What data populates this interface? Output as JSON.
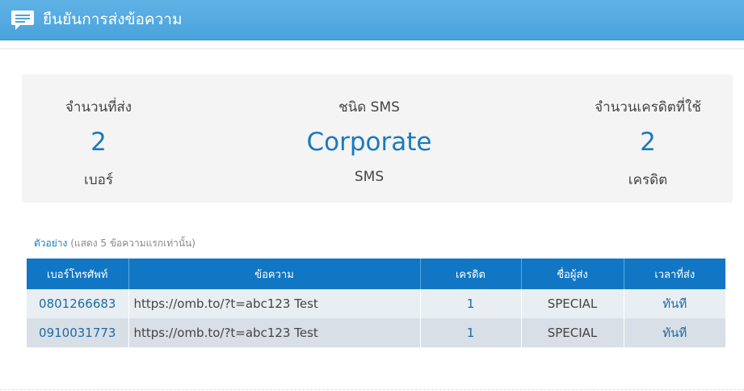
{
  "header": {
    "title": "ยืนยันการส่งข้อความ",
    "icon": "chat-icon"
  },
  "summary": {
    "count_label": "จำนวนที่ส่ง",
    "count_value": "2",
    "count_unit": "เบอร์",
    "type_label": "ชนิด SMS",
    "type_value": "Corporate",
    "type_unit": "SMS",
    "credit_label": "จำนวนเครดิตที่ใช้",
    "credit_value": "2",
    "credit_unit": "เครดิต"
  },
  "preview": {
    "lead": "ตัวอย่าง",
    "note": " (แสดง 5 ข้อความแรกเท่านั้น)"
  },
  "table": {
    "columns": [
      "เบอร์โทรศัพท์",
      "ข้อความ",
      "เครดิต",
      "ชื่อผู้ส่ง",
      "เวลาที่ส่ง"
    ],
    "rows": [
      {
        "phone": "0801266683",
        "message": "https://omb.to/?t=abc123 Test",
        "credit": "1",
        "sender": "SPECIAL",
        "time": "ทันที"
      },
      {
        "phone": "0910031773",
        "message": "https://omb.to/?t=abc123 Test",
        "credit": "1",
        "sender": "SPECIAL",
        "time": "ทันที"
      }
    ]
  },
  "colors": {
    "header": "#4aa3dc",
    "table_header": "#1177c4",
    "accent_text": "#1a7abd"
  }
}
